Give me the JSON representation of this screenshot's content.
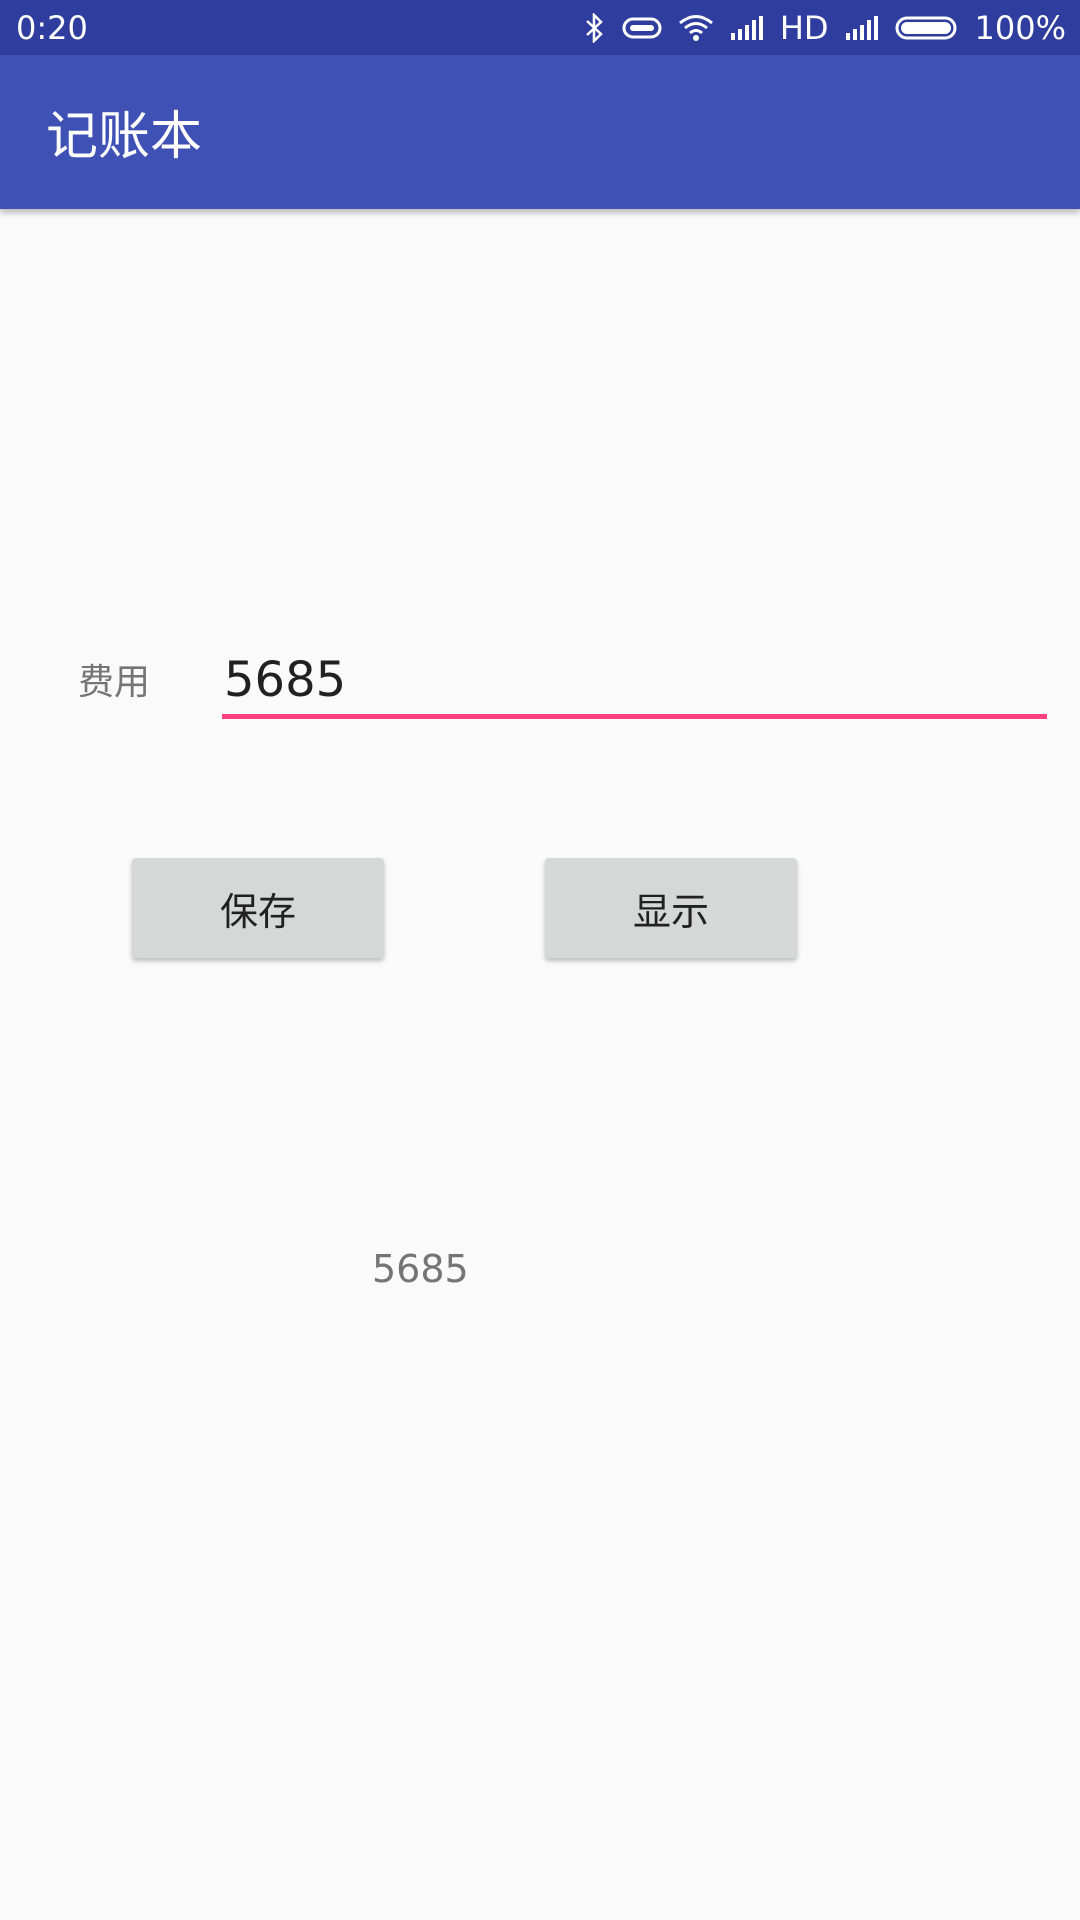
{
  "status_bar": {
    "time": "0:20",
    "network": "HD",
    "battery": "100%",
    "icons": [
      "bluetooth-icon",
      "link-icon",
      "wifi-icon",
      "signal-icon",
      "signal-icon",
      "battery-icon"
    ]
  },
  "app_bar": {
    "title": "记账本",
    "color": "#3f51b5"
  },
  "form": {
    "fee_label": "费用",
    "fee_value": "5685",
    "accent": "#ff4081"
  },
  "buttons": {
    "save_label": "保存",
    "show_label": "显示"
  },
  "result": {
    "text": "5685"
  }
}
